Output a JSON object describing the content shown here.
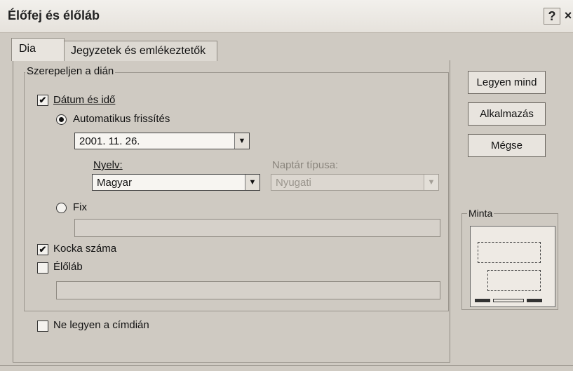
{
  "window": {
    "title": "Élőfej és élőláb",
    "help": "?",
    "close": "×"
  },
  "tabs": [
    {
      "label": "Dia"
    },
    {
      "label": "Jegyzetek és emlékeztetők"
    }
  ],
  "group": {
    "legend": "Szerepeljen a dián",
    "datum": {
      "label": "Dátum és idő",
      "checked": true
    },
    "auto": {
      "label": "Automatikus frissítés",
      "selected": true
    },
    "date_value": "2001. 11. 26.",
    "nyelv_label": "Nyelv:",
    "nyelv_value": "Magyar",
    "naptar_label": "Naptár típusa:",
    "naptar_value": "Nyugati",
    "fix": {
      "label": "Fix",
      "selected": false
    },
    "kocka": {
      "label": "Kocka száma",
      "checked": true
    },
    "eloläb": {
      "label": "Élőláb",
      "checked": false
    }
  },
  "no_title": {
    "label": "Ne legyen a címdián",
    "checked": false
  },
  "buttons": {
    "legyen_mind": "Legyen mind",
    "alkalmazas": "Alkalmazás",
    "megse": "Mégse"
  },
  "preview": {
    "legend": "Minta"
  },
  "glyphs": {
    "check": "✔",
    "dropdown": "▼"
  }
}
